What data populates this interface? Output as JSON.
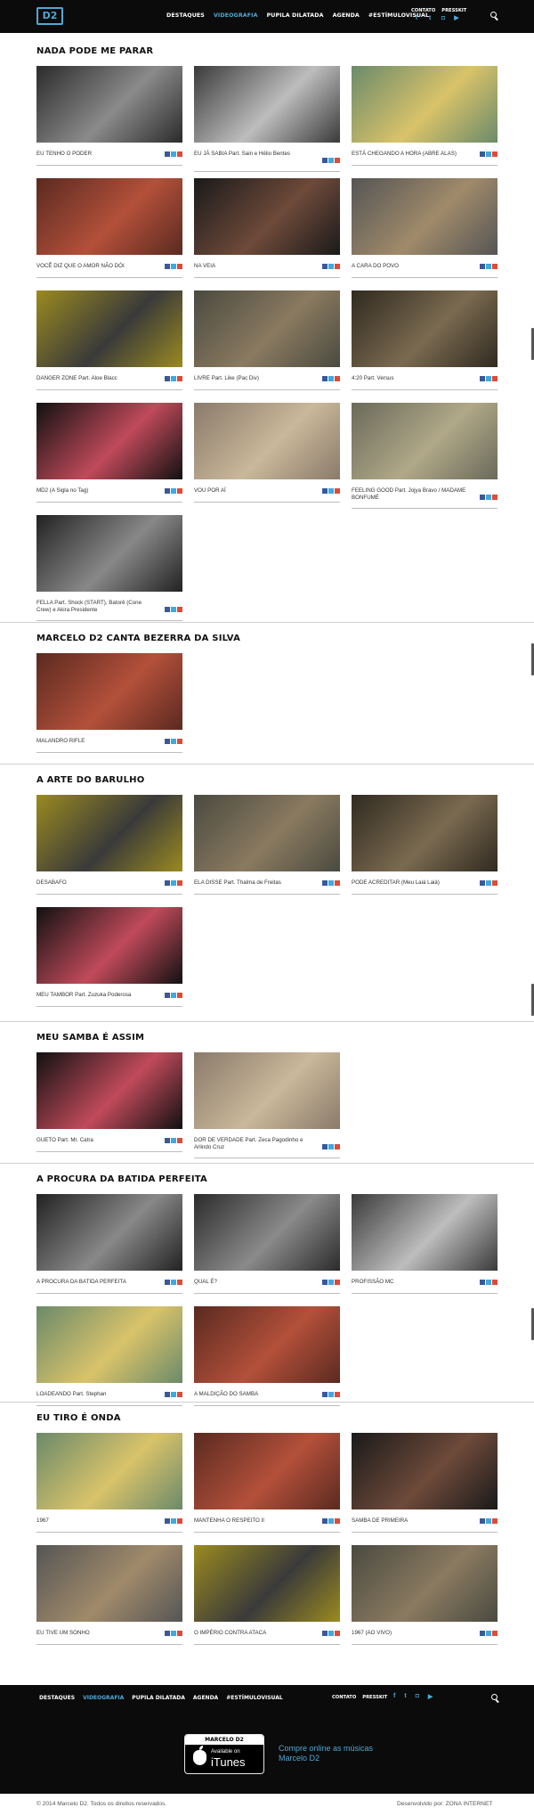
{
  "header": {
    "logo": "D2",
    "nav": [
      "DESTAQUES",
      "VIDEOGRAFIA",
      "PUPILA DILATADA",
      "AGENDA",
      "#ESTÍMULOVISUAL"
    ],
    "contato": "CONTATO",
    "presskit": "PRESSKIT",
    "social": [
      "facebook-icon",
      "twitter-icon",
      "instagram-icon",
      "youtube-icon"
    ]
  },
  "sections": [
    {
      "title": "NADA PODE ME PARAR",
      "videos": [
        {
          "caption": "EU TENHO O PODER"
        },
        {
          "caption": "EU JÁ SABIA Part. Sain e Hélio Bentes"
        },
        {
          "caption": "ESTÁ CHEGANDO A HORA (ABRE ALAS)"
        },
        {
          "caption": "VOCÊ DIZ QUE O AMOR NÃO DÓI"
        },
        {
          "caption": "NA VEIA"
        },
        {
          "caption": "A CARA DO POVO"
        },
        {
          "caption": "DANGER ZONE Part. Aloe Blacc"
        },
        {
          "caption": "LIVRE Part. Like (Pac Div)"
        },
        {
          "caption": "4:20 Part. Versus"
        },
        {
          "caption": "MD2 (A Sigla no Tag)"
        },
        {
          "caption": "VOU POR AÍ"
        },
        {
          "caption": "FEELING GOOD Part. Jojya Bravo / MADAME BONFUMÉ"
        },
        {
          "caption": "FELLA Part. Shock (START), Batorê (Cone Crew) e Akira Presidente"
        }
      ]
    },
    {
      "title": "MARCELO D2 CANTA BEZERRA DA SILVA",
      "videos": [
        {
          "caption": "MALANDRO RIFLE"
        }
      ]
    },
    {
      "title": "A ARTE DO BARULHO",
      "videos": [
        {
          "caption": "DESABAFO"
        },
        {
          "caption": "ELA DISSE Part. Thalma de Freitas"
        },
        {
          "caption": "PODE ACREDITAR (Meu Laiá Laiá)"
        },
        {
          "caption": "MEU TAMBOR Part. Zuzuka Poderosa"
        }
      ]
    },
    {
      "title": "MEU SAMBA É ASSIM",
      "videos": [
        {
          "caption": "GUETO Part. Mr. Catra"
        },
        {
          "caption": "DOR DE VERDADE Part. Zeca Pagodinho e Arlindo Cruz"
        }
      ]
    },
    {
      "title": "A PROCURA DA BATIDA PERFEITA",
      "videos": [
        {
          "caption": "A PROCURA DA BATIDA PERFEITA"
        },
        {
          "caption": "QUAL É?"
        },
        {
          "caption": "PROFISSÃO MC"
        },
        {
          "caption": "LOADEANDO Part. Stephan"
        },
        {
          "caption": "A MALDIÇÃO DO SAMBA"
        }
      ]
    },
    {
      "title": "EU TIRO É ONDA",
      "videos": [
        {
          "caption": "1967"
        },
        {
          "caption": "MANTENHA O RESPEITO II"
        },
        {
          "caption": "SAMBA DE PRIMEIRA"
        },
        {
          "caption": "EU TIVE UM SONHO"
        },
        {
          "caption": "O IMPÉRIO CONTRA ATACA"
        },
        {
          "caption": "1967 (AO VIVO)"
        }
      ]
    }
  ],
  "footer": {
    "nav": [
      "DESTAQUES",
      "VIDEOGRAFIA",
      "PUPILA DILATADA",
      "AGENDA",
      "#ESTÍMULOVISUAL"
    ],
    "contato": "CONTATO",
    "presskit": "PRESSKIT",
    "itunes_header": "MARCELO D2",
    "itunes_available": "Available on",
    "itunes_brand": "iTunes",
    "buy_text": "Compre online as músicas Marcelo D2",
    "copyright": "© 2014 Marcelo D2. Todos os direitos reservados.",
    "developer": "Desenvolvido por: ZONA INTERNET"
  },
  "colors": {
    "accent": "#4ea9d6",
    "header_bg": "#0b0b0b",
    "share_facebook": "#3b5998",
    "share_twitter": "#3fa9e0",
    "share_google": "#dd4b39"
  }
}
